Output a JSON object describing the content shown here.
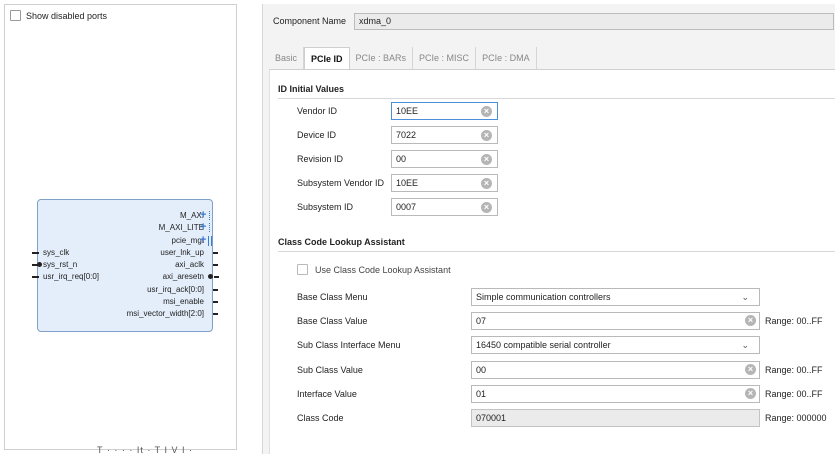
{
  "left_panel": {
    "show_disabled_label": "Show disabled ports",
    "ip_block": {
      "right_ports": [
        {
          "label": "M_AXI",
          "pin": "plus-dots"
        },
        {
          "label": "M_AXI_LITE",
          "pin": "plus-dots"
        },
        {
          "label": "pcie_mgt",
          "pin": "plus-bars"
        },
        {
          "label": "user_lnk_up",
          "pin": "stub"
        },
        {
          "label": "axi_aclk",
          "pin": "stub"
        },
        {
          "label": "axi_aresetn",
          "pin": "circle"
        },
        {
          "label": "usr_irq_ack[0:0]",
          "pin": "stub"
        },
        {
          "label": "msi_enable",
          "pin": "stub"
        },
        {
          "label": "msi_vector_width[2:0]",
          "pin": "stub"
        }
      ],
      "left_ports": [
        {
          "label": "sys_clk",
          "pin": "stub"
        },
        {
          "label": "sys_rst_n",
          "pin": "circle"
        },
        {
          "label": "usr_irq_req[0:0]",
          "pin": "stub"
        }
      ]
    }
  },
  "bottom_hint": "T   ·   ·   ·   ·   It  ·   T  I  V  I  ·",
  "right_panel": {
    "component_name_label": "Component Name",
    "component_name_value": "xdma_0",
    "tabs": [
      {
        "label": "Basic",
        "active": false
      },
      {
        "label": "PCIe ID",
        "active": true
      },
      {
        "label": "PCIe : BARs",
        "active": false
      },
      {
        "label": "PCIe : MISC",
        "active": false
      },
      {
        "label": "PCIe : DMA",
        "active": false
      }
    ],
    "id_section": {
      "title": "ID Initial Values",
      "fields": [
        {
          "label": "Vendor ID",
          "value": "10EE"
        },
        {
          "label": "Device ID",
          "value": "7022"
        },
        {
          "label": "Revision ID",
          "value": "00"
        },
        {
          "label": "Subsystem Vendor ID",
          "value": "10EE"
        },
        {
          "label": "Subsystem ID",
          "value": "0007"
        }
      ]
    },
    "class_section": {
      "title": "Class Code Lookup Assistant",
      "use_lookup_label": "Use Class Code Lookup Assistant",
      "rows": [
        {
          "label": "Base Class Menu",
          "value": "Simple communication controllers",
          "kind": "select",
          "range": ""
        },
        {
          "label": "Base Class Value",
          "value": "07",
          "kind": "input",
          "range": "Range: 00..FF"
        },
        {
          "label": "Sub Class Interface Menu",
          "value": "16450 compatible serial controller",
          "kind": "select",
          "range": ""
        },
        {
          "label": "Sub Class Value",
          "value": "00",
          "kind": "input",
          "range": "Range: 00..FF"
        },
        {
          "label": "Interface Value",
          "value": "01",
          "kind": "input",
          "range": "Range: 00..FF"
        },
        {
          "label": "Class Code",
          "value": "070001",
          "kind": "readonly",
          "range": "Range: 000000"
        }
      ]
    }
  },
  "colors": {
    "accent": "#4a8fd8",
    "ip_block_fill": "#e4eefa",
    "ip_block_border": "#7fa0c8",
    "port_plus": "#3b7bd4"
  },
  "icons": {
    "clear": "clear-circle-x-icon",
    "dropdown": "chevron-down-icon"
  }
}
